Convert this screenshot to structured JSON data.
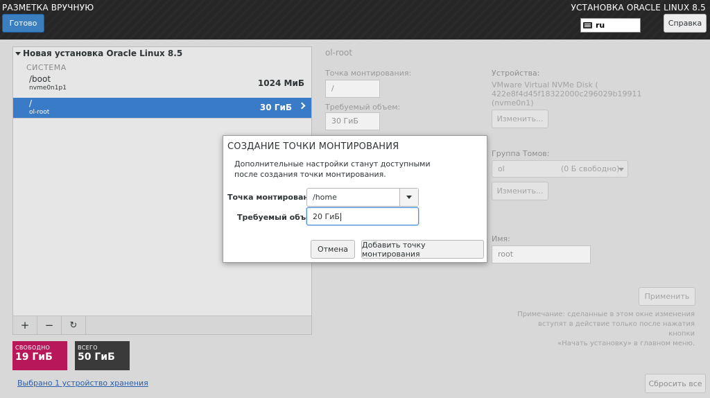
{
  "header": {
    "title": "РАЗМЕТКА ВРУЧНУЮ",
    "product": "УСТАНОВКА ORACLE LINUX 8.5",
    "done_label": "Готово",
    "keyboard_layout": "ru",
    "help_label": "Справка"
  },
  "left_panel": {
    "install_title": "Новая установка Oracle Linux 8.5",
    "section_label": "СИСТЕМА",
    "mount_points": [
      {
        "name": "/boot",
        "device": "nvme0n1p1",
        "size": "1024 МиБ",
        "selected": false
      },
      {
        "name": "/",
        "device": "ol-root",
        "size": "30 ГиБ",
        "selected": true
      }
    ],
    "tools": {
      "add": "+",
      "remove": "−",
      "refresh": "↻"
    }
  },
  "space": {
    "free_label": "СВОБОДНО",
    "free_value": "19 ГиБ",
    "total_label": "ВСЕГО",
    "total_value": "50 ГиБ",
    "free_color": "#b8185a",
    "total_color": "#3a3a3a"
  },
  "storage_link": "Выбрано 1 устройство хранения",
  "right_panel": {
    "title": "ol-root",
    "mount_point_label": "Точка монтирования:",
    "mount_point_value": "/",
    "capacity_label": "Требуемый объем:",
    "capacity_value": "30 ГиБ",
    "devices_label": "Устройства:",
    "device_line1": "VMware Virtual NVMe Disk (",
    "device_line2": "422e8f4d45f18322000c296029b19911",
    "device_line3": "(nvme0n1)",
    "modify_devices_label": "Изменить...",
    "volume_group_label": "Группа Томов:",
    "volume_group_name": "ol",
    "volume_group_free": "(0 Б свободно)",
    "modify_vg_label": "Изменить...",
    "name_label": "Имя:",
    "name_value": "root",
    "apply_label": "Применить",
    "note_line1": "Примечание:  сделанные в этом окне изменения",
    "note_line2": "вступят в действие только после нажатия кнопки",
    "note_line3": "«Начать установку» в главном меню.",
    "reset_label": "Сбросить все"
  },
  "dialog": {
    "title": "СОЗДАНИЕ ТОЧКИ МОНТИРОВАНИЯ",
    "desc_line1": "Дополнительные настройки станут доступными",
    "desc_line2": "после создания точки монтирования.",
    "mount_point_label": "Точка монтирования:",
    "mount_point_value": "/home",
    "capacity_label": "Требуемый объем:",
    "capacity_value": "20 ГиБ",
    "cancel_label": "Отмена",
    "add_label": "Добавить точку монтирования"
  }
}
